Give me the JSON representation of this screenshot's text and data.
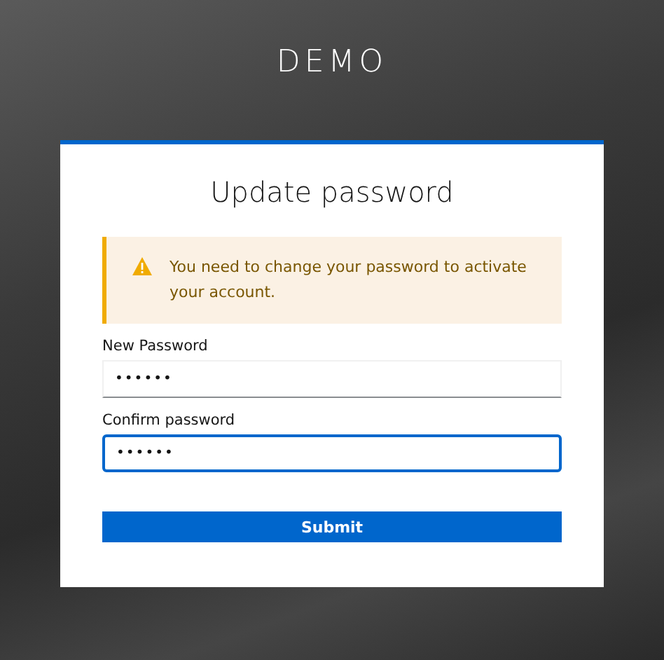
{
  "brand": "DEMO",
  "card": {
    "title": "Update password",
    "alert": {
      "kind": "warning",
      "message": "You need to change your password to activate your account."
    },
    "fields": [
      {
        "label": "New Password",
        "value": "••••••",
        "focused": false
      },
      {
        "label": "Confirm password",
        "value": "••••••",
        "focused": true
      }
    ],
    "submit": "Submit"
  }
}
